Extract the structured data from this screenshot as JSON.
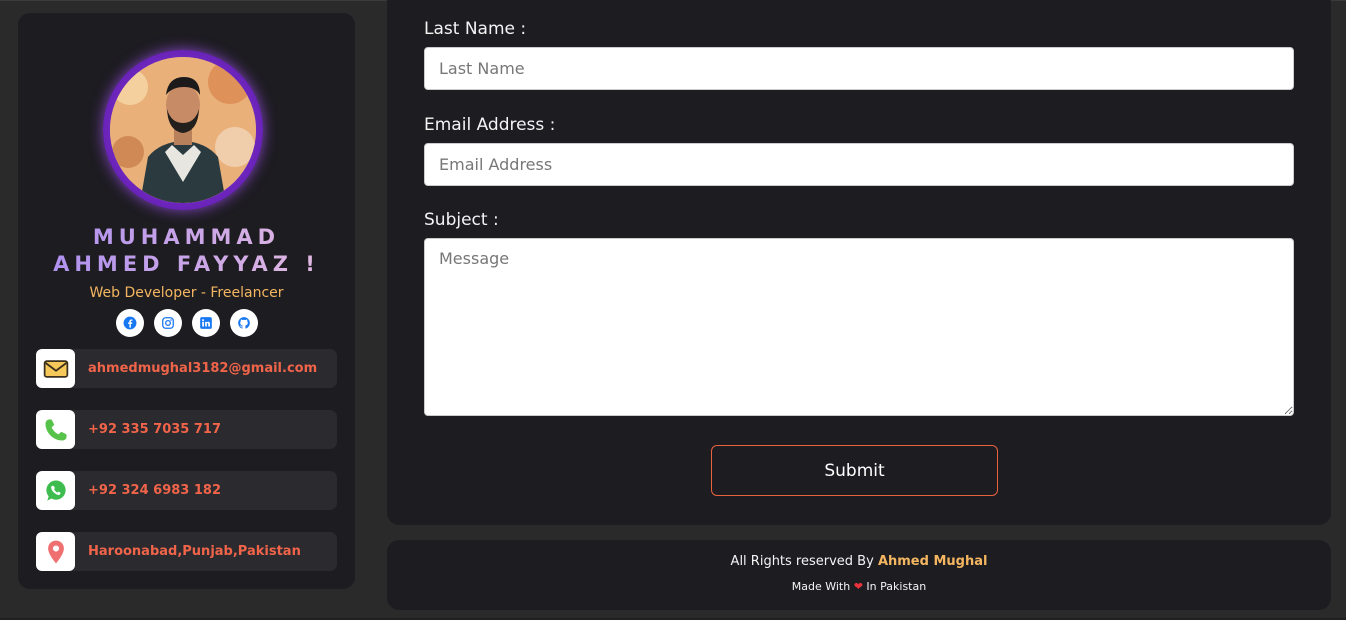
{
  "profile": {
    "name_line1": "MUHAMMAD",
    "name_line2": "AHMED FAYYAZ !",
    "role": "Web Developer - Freelancer",
    "socials": [
      "facebook-icon",
      "instagram-icon",
      "linkedin-icon",
      "github-icon"
    ]
  },
  "contacts": [
    {
      "icon": "mail-icon",
      "text": "ahmedmughal3182@gmail.com"
    },
    {
      "icon": "phone-icon",
      "text": "+92 335 7035 717"
    },
    {
      "icon": "whatsapp-icon",
      "text": "+92 324 6983 182"
    },
    {
      "icon": "location-icon",
      "text": "Haroonabad,Punjab,Pakistan"
    }
  ],
  "form": {
    "last_name_label": "Last Name :",
    "last_name_placeholder": "Last Name",
    "email_label": "Email Address :",
    "email_placeholder": "Email Address",
    "subject_label": "Subject :",
    "message_placeholder": "Message",
    "submit_label": "Submit"
  },
  "footer": {
    "rights_prefix": "All Rights reserved By ",
    "author": "Ahmed Mughal",
    "made_prefix": "Made With ",
    "heart": "❤",
    "made_suffix": " In Pakistan"
  },
  "colors": {
    "background": "#2a2a2a",
    "panel": "#1d1c21",
    "accent_orange": "#f0644a",
    "accent_gold": "#f4b660",
    "accent_purple": "#a98cf0"
  }
}
